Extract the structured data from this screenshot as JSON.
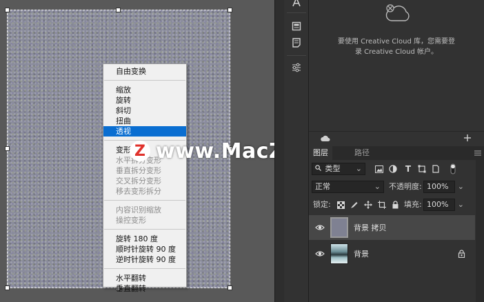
{
  "context_menu": {
    "groups": [
      [
        {
          "label": "自由变换",
          "disabled": false
        }
      ],
      [
        {
          "label": "缩放",
          "disabled": false
        },
        {
          "label": "旋转",
          "disabled": false
        },
        {
          "label": "斜切",
          "disabled": false
        },
        {
          "label": "扭曲",
          "disabled": false
        },
        {
          "label": "透视",
          "disabled": false,
          "selected": true
        }
      ],
      [
        {
          "label": "变形",
          "disabled": false
        },
        {
          "label": "水平拆分变形",
          "disabled": true
        },
        {
          "label": "垂直拆分变形",
          "disabled": true
        },
        {
          "label": "交叉拆分变形",
          "disabled": true
        },
        {
          "label": "移去变形拆分",
          "disabled": true
        }
      ],
      [
        {
          "label": "内容识别缩放",
          "disabled": true
        },
        {
          "label": "操控变形",
          "disabled": true
        }
      ],
      [
        {
          "label": "旋转 180 度",
          "disabled": false
        },
        {
          "label": "顺时针旋转 90 度",
          "disabled": false
        },
        {
          "label": "逆时针旋转 90 度",
          "disabled": false
        }
      ],
      [
        {
          "label": "水平翻转",
          "disabled": false
        },
        {
          "label": "垂直翻转",
          "disabled": false
        }
      ]
    ]
  },
  "watermark": {
    "text": "www.MacZ.com",
    "badge": "Z"
  },
  "creative_cloud": {
    "message_line1": "要使用 Creative Cloud 库，您需要登",
    "message_line2": "录 Creative Cloud 帐户。"
  },
  "layers_panel": {
    "tabs": [
      {
        "label": "图层",
        "active": true
      },
      {
        "label": "路径",
        "active": false
      }
    ],
    "filter_kind": "类型",
    "blend_mode": "正常",
    "opacity_label": "不透明度:",
    "opacity_value": "100%",
    "lock_label": "锁定:",
    "fill_label": "填充:",
    "fill_value": "100%",
    "layers": [
      {
        "name": "背景 拷贝",
        "active": true,
        "locked": false
      },
      {
        "name": "背景",
        "active": false,
        "locked": true
      }
    ]
  },
  "colors": {
    "menu_highlight": "#0a6ed1",
    "panel_bg": "#323232",
    "canvas_bg": "#595959"
  }
}
